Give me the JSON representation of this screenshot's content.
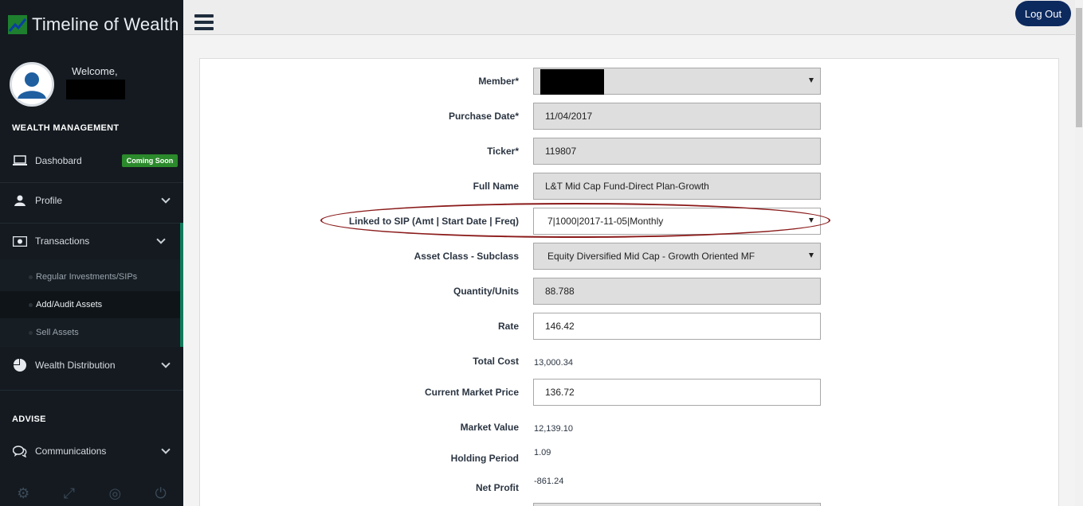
{
  "app": {
    "title": "Timeline of Wealth"
  },
  "user": {
    "welcome": "Welcome,"
  },
  "sidebar": {
    "sections": {
      "wealth": "WEALTH MANAGEMENT",
      "advise": "ADVISE"
    },
    "items": {
      "dashboard": {
        "label": "Dashobard",
        "badge": "Coming Soon"
      },
      "profile": {
        "label": "Profile"
      },
      "transactions": {
        "label": "Transactions"
      },
      "wealth_distribution": {
        "label": "Wealth Distribution"
      },
      "communications": {
        "label": "Communications"
      }
    },
    "sub_items": {
      "regular": "Regular Investments/SIPs",
      "add_audit": "Add/Audit Assets",
      "sell": "Sell Assets"
    }
  },
  "topbar": {
    "logout_label": "Log Out"
  },
  "form": {
    "member": {
      "label": "Member*"
    },
    "purchase_date": {
      "label": "Purchase Date*",
      "value": "11/04/2017"
    },
    "ticker": {
      "label": "Ticker*",
      "value": "119807"
    },
    "full_name": {
      "label": "Full Name",
      "value": "L&T Mid Cap Fund-Direct Plan-Growth"
    },
    "linked_sip": {
      "label": "Linked to SIP (Amt | Start Date | Freq)",
      "value": "7|1000|2017-11-05|Monthly"
    },
    "asset_class": {
      "label": "Asset Class - Subclass",
      "value": "Equity Diversified Mid Cap - Growth Oriented MF"
    },
    "quantity": {
      "label": "Quantity/Units",
      "value": "88.788"
    },
    "rate": {
      "label": "Rate",
      "value": "146.42"
    },
    "total_cost": {
      "label": "Total Cost",
      "value": "13,000.34"
    },
    "cmp": {
      "label": "Current Market Price",
      "value": "136.72"
    },
    "market_value": {
      "label": "Market Value",
      "value": "12,139.10"
    },
    "holding_period": {
      "label": "Holding Period",
      "value": "1.09"
    },
    "net_profit": {
      "label": "Net Profit",
      "value": "-861.24"
    }
  }
}
